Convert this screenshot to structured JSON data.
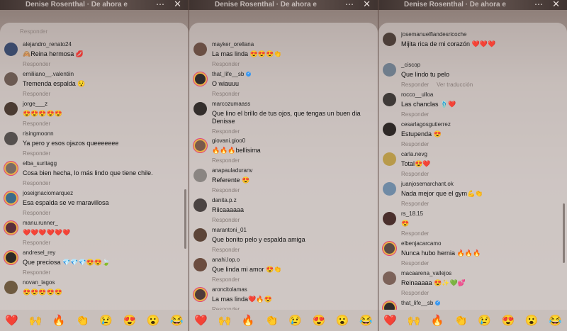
{
  "header": {
    "live_title": "Denise Rosenthal · De ahora e",
    "more_icon": "more-icon",
    "close_icon": "close-icon"
  },
  "reply_label": "Responder",
  "translate_label": "Ver traducción",
  "reactions": [
    "❤️",
    "🙌",
    "🔥",
    "👏",
    "😢",
    "😍",
    "😮",
    "😂"
  ],
  "panels": [
    {
      "top_fragment": "Responder",
      "comments": [
        {
          "user": "alejandro_renato24",
          "text": "🙈Reina hermosa 💋"
        },
        {
          "user": "emiliiano__.valentiin",
          "text": "Tremenda espalda 😯"
        },
        {
          "user": "jorge___z",
          "text": "😍😍😍😍😍"
        },
        {
          "user": "risingmoonn",
          "text": "Ya pero y esos ojazos queeeeeee"
        },
        {
          "user": "elba_suritagg",
          "text": "Cosa bien hecha, lo más lindo que tiene chile."
        },
        {
          "user": "joseignaciomarquez",
          "text": "Esa espalda se ve maravillosa"
        },
        {
          "user": "manu.runner_",
          "text": "❤️❤️❤️❤️❤️❤️"
        },
        {
          "user": "andresel_rey",
          "text": "Que preciosa 💎💎💎😍😍🍃"
        },
        {
          "user": "novan_lagos",
          "text": "😍😍😍😍😍"
        }
      ]
    },
    {
      "comments": [
        {
          "user": "mayker_orellana",
          "text": "La mas linda 😍😍😍👏"
        },
        {
          "user": "that_life__sb",
          "text": "O wiauuu"
        },
        {
          "user": "marcozumaass",
          "text": "Que lino el  brillo de tus ojos,  que tengas un buen dia Denisse"
        },
        {
          "user": "giovani.gioo0",
          "text": "🔥🔥🔥bellisima"
        },
        {
          "user": "anapauladuranv",
          "text": "Referente 😍"
        },
        {
          "user": "danita.p.z",
          "text": "Riicaaaaaa"
        },
        {
          "user": "marantoni_01",
          "text": "Que bonito pelo y espalda amiga"
        },
        {
          "user": "anahi.lop.o",
          "text": "Que linda mi amor 😍👏"
        },
        {
          "user": "aroncitolamas",
          "text": "La mas linda❤️🔥😍"
        }
      ]
    },
    {
      "comments": [
        {
          "user": "josemanuelfiandesricoche",
          "text": "Mijita rica de mi corazón ❤️❤️❤️"
        },
        {
          "user": "_ciscop",
          "text": "Que lindo tu pelo"
        },
        {
          "user": "rocco__ulloa",
          "text": "Las chanclas 🩴❤️"
        },
        {
          "user": "cesarlagosgutierrez",
          "text": "Estupenda 😍"
        },
        {
          "user": "carla.nevg",
          "text": "Total😍❤️"
        },
        {
          "user": "juanjosemarchant.ok",
          "text": "Nada mejor que el gym💪👏"
        },
        {
          "user": "rs_18.15",
          "text": "😍"
        },
        {
          "user": "elbenjacarcamo",
          "text": "Nunca hubo hernia 🔥🔥🔥"
        },
        {
          "user": "macaarena_vallejos",
          "text": "Reinaaaaa 😍✨💚💕"
        },
        {
          "user": "that_life__sb",
          "text": ""
        }
      ]
    }
  ]
}
